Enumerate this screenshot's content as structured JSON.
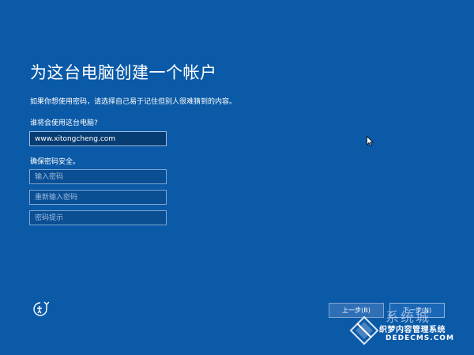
{
  "page": {
    "title": "为这台电脑创建一个帐户",
    "description": "如果你想使用密码，请选择自己易于记住但别人很难猜到的内容。",
    "user_label": "谁将会使用这台电脑?",
    "security_label": "确保密码安全。"
  },
  "fields": {
    "username_value": "www.xitongcheng.com",
    "password_placeholder": "输入密码",
    "confirm_placeholder": "重新输入密码",
    "hint_placeholder": "密码提示"
  },
  "buttons": {
    "back_label": "上一步(B)",
    "next_label": "下一步(N)"
  },
  "icons": {
    "accessibility": "ease-of-access-icon",
    "cursor": "mouse-pointer-icon"
  },
  "watermark": {
    "big_text": "系统城",
    "line1": "织梦内容管理系统",
    "line2": "DEDECMS.COM"
  },
  "colors": {
    "background": "#0b5aa8",
    "field": "#0a4e93",
    "button": "#2e6fb5"
  }
}
